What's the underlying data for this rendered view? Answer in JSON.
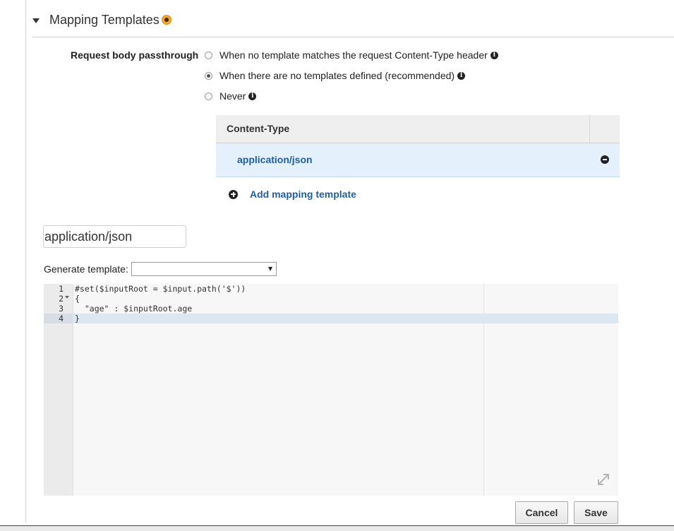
{
  "section": {
    "title": "Mapping Templates"
  },
  "passthrough": {
    "label": "Request body passthrough",
    "options": [
      {
        "label": "When no template matches the request Content-Type header",
        "selected": false
      },
      {
        "label": "When there are no templates defined (recommended)",
        "selected": true
      },
      {
        "label": "Never",
        "selected": false
      }
    ]
  },
  "content_types": {
    "header": "Content-Type",
    "rows": [
      {
        "label": "application/json"
      }
    ],
    "add_label": "Add mapping template"
  },
  "content_type_input": {
    "value": "application/json"
  },
  "generate_template": {
    "label": "Generate template:",
    "selected": ""
  },
  "editor": {
    "line_numbers": [
      "1",
      "2",
      "3",
      "4"
    ],
    "lines": [
      "#set($inputRoot = $input.path('$'))",
      "{",
      "  \"age\" : $inputRoot.age",
      "}"
    ]
  },
  "buttons": {
    "cancel": "Cancel",
    "save": "Save"
  },
  "colors": {
    "link": "#1f5fa8",
    "status_dot": "#f5a623",
    "selected_row": "#e4f0fb"
  },
  "icons": {
    "status": "status-dot-icon",
    "info": "info-icon",
    "remove": "minus-circle-icon",
    "add": "plus-circle-icon",
    "expand": "expand-icon"
  }
}
